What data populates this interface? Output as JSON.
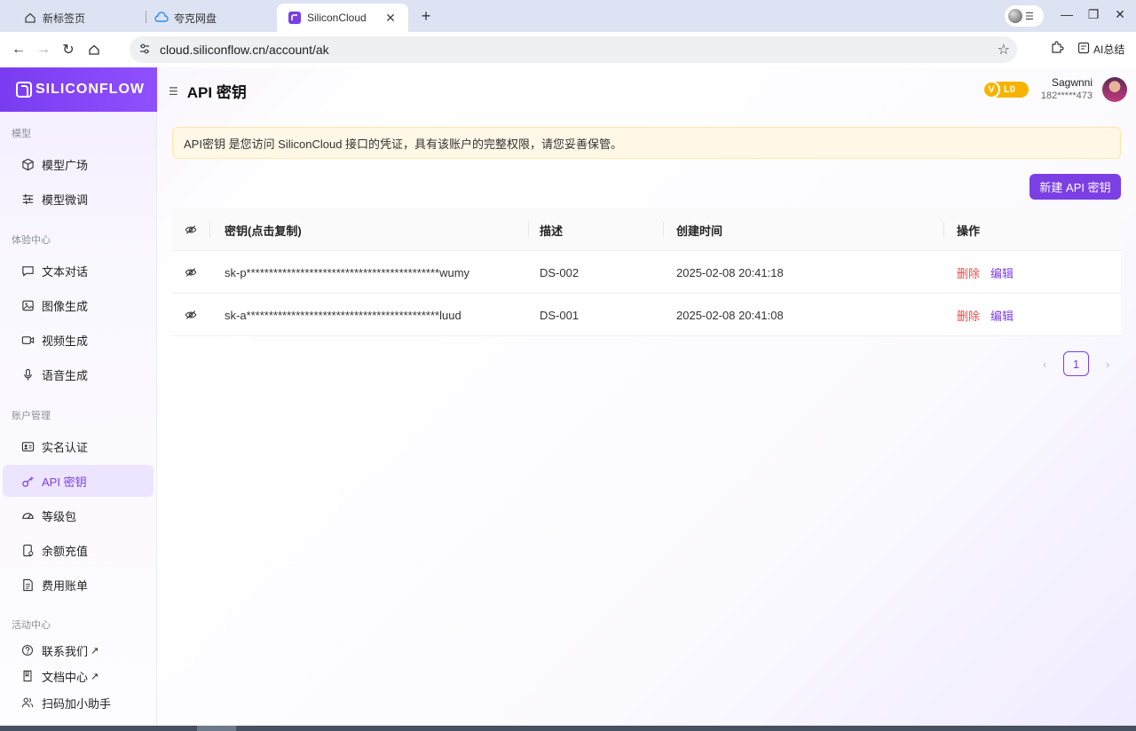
{
  "browser": {
    "tabs": [
      {
        "label": "新标签页",
        "icon": "home-icon"
      },
      {
        "label": "夸克网盘",
        "icon": "cloud-icon"
      },
      {
        "label": "SiliconCloud",
        "icon": "siliconflow-icon",
        "active": true
      }
    ],
    "url": "cloud.siliconflow.cn/account/ak",
    "ai_summary": "AI总结"
  },
  "app": {
    "brand": "SILICONFLOW",
    "page_title": "API 密钥",
    "user": {
      "name": "Sagwnni",
      "phone": "182*****473",
      "level": "L0",
      "level_icon": "V"
    },
    "sidebar": {
      "sections": [
        {
          "label": "模型",
          "items": [
            {
              "label": "模型广场",
              "icon": "cube-icon"
            },
            {
              "label": "模型微调",
              "icon": "sliders-icon"
            }
          ]
        },
        {
          "label": "体验中心",
          "items": [
            {
              "label": "文本对话",
              "icon": "chat-icon"
            },
            {
              "label": "图像生成",
              "icon": "image-icon"
            },
            {
              "label": "视频生成",
              "icon": "video-icon"
            },
            {
              "label": "语音生成",
              "icon": "mic-icon"
            }
          ]
        },
        {
          "label": "账户管理",
          "items": [
            {
              "label": "实名认证",
              "icon": "id-card-icon"
            },
            {
              "label": "API 密钥",
              "icon": "key-icon",
              "active": true
            },
            {
              "label": "等级包",
              "icon": "gauge-icon"
            },
            {
              "label": "余额充值",
              "icon": "wallet-icon"
            },
            {
              "label": "费用账单",
              "icon": "bill-icon"
            }
          ]
        },
        {
          "label": "活动中心",
          "items": [
            {
              "label": "联系我们",
              "icon": "help-icon",
              "external": "↗"
            },
            {
              "label": "文档中心",
              "icon": "book-icon",
              "external": "↗"
            },
            {
              "label": "扫码加小助手",
              "icon": "people-icon"
            }
          ]
        }
      ]
    },
    "notice": "API密钥 是您访问 SiliconCloud 接口的凭证，具有该账户的完整权限，请您妥善保管。",
    "new_key_button": "新建 API 密钥",
    "table": {
      "headers": {
        "key": "密钥(点击复制)",
        "desc": "描述",
        "created": "创建时间",
        "actions": "操作"
      },
      "rows": [
        {
          "key": "sk-p*******************************************wumy",
          "desc": "DS-002",
          "created": "2025-02-08 20:41:18",
          "delete": "删除",
          "edit": "编辑"
        },
        {
          "key": "sk-a*******************************************luud",
          "desc": "DS-001",
          "created": "2025-02-08 20:41:08",
          "delete": "删除",
          "edit": "编辑"
        }
      ]
    },
    "pagination": {
      "prev": "‹",
      "current": "1",
      "next": "›"
    }
  },
  "colors": {
    "accent": "#7b3fe4",
    "danger": "#f04a4a",
    "notice_bg": "#fff8e6",
    "level_badge": "#f6b400"
  }
}
